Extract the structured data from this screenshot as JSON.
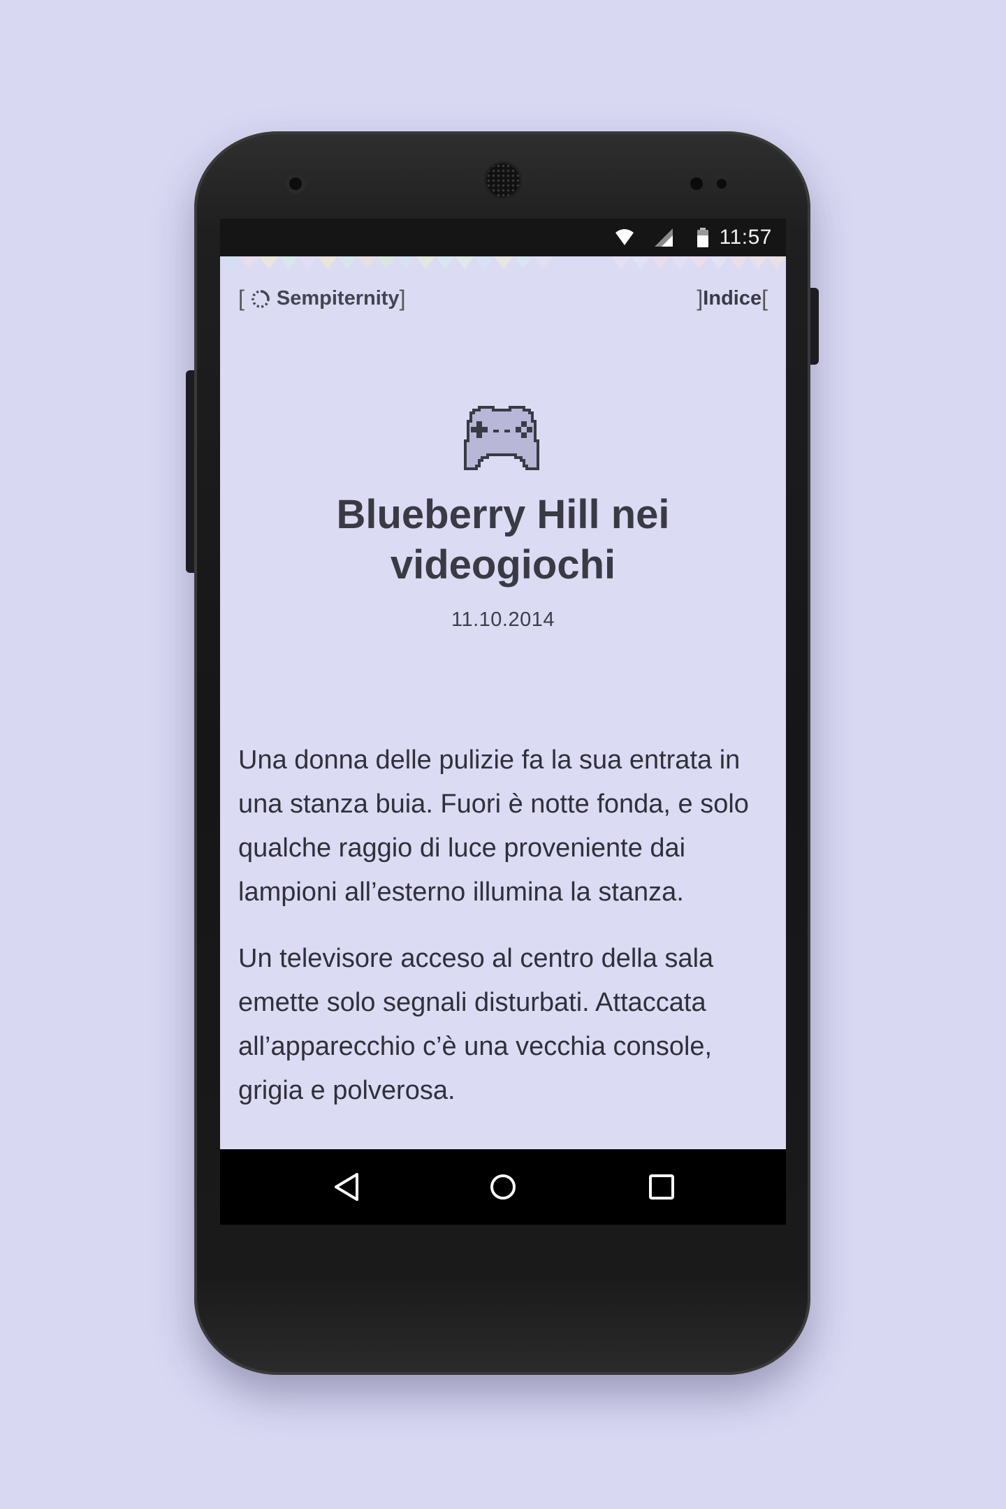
{
  "status_bar": {
    "time": "11:57"
  },
  "header": {
    "brand_bracket_open": "[",
    "brand_name": "Sempiternity",
    "brand_bracket_close": "]",
    "index_bracket_open": "]",
    "index_label": "Indice",
    "index_bracket_close": "["
  },
  "post": {
    "title": "Blueberry Hill nei videogiochi",
    "date": "11.10.2014",
    "paragraphs": [
      "Una donna delle pulizie fa la sua entrata in una stanza buia. Fuori è notte fonda, e solo qualche raggio di luce proveniente dai lampioni all’esterno illumina la stanza.",
      "Un televisore acceso al centro della sala emette solo segnali disturbati. Attaccata all’apparecchio c’è una vecchia console, grigia e polverosa."
    ]
  },
  "colors": {
    "background": "#d9d8f3",
    "screen_background": "#dcdbf4",
    "text": "#30303a"
  },
  "icons": {
    "wifi": "wifi-icon",
    "signal": "signal-icon",
    "battery": "battery-icon",
    "spinner": "spinner-icon",
    "gamepad": "gamepad-icon",
    "back": "back-icon",
    "home": "home-icon",
    "recents": "recents-icon"
  }
}
